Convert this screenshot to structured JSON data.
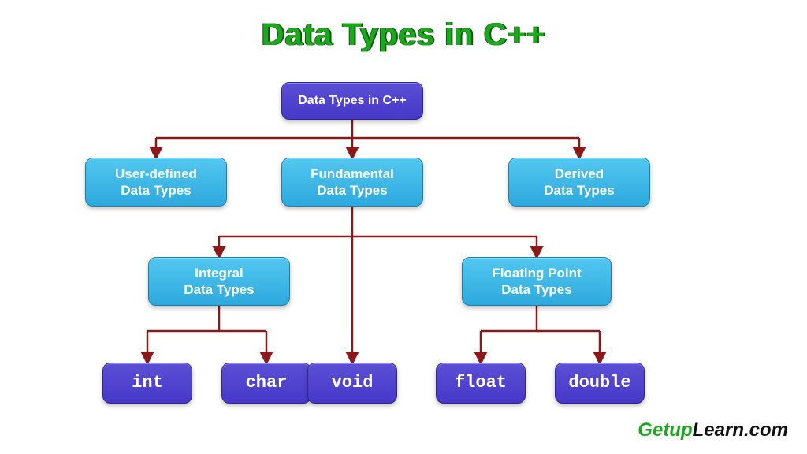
{
  "title": "Data Types in C++",
  "watermark": {
    "part1": "Getup",
    "part2": "Learn",
    "part3": ".com"
  },
  "nodes": {
    "root": "Data Types in C++",
    "userdef": "User-defined\nData Types",
    "fundamental": "Fundamental\nData  Types",
    "derived": "Derived\nData Types",
    "integral": "Integral\nData Types",
    "floating": "Floating  Point\nData Types",
    "int": "int",
    "char": "char",
    "void": "void",
    "float": "float",
    "double": "double"
  },
  "chart_data": {
    "type": "tree",
    "title": "Data Types in C++",
    "root": {
      "label": "Data Types in C++",
      "children": [
        {
          "label": "User-defined Data Types"
        },
        {
          "label": "Fundamental Data Types",
          "children": [
            {
              "label": "Integral Data Types",
              "children": [
                {
                  "label": "int"
                },
                {
                  "label": "char"
                }
              ]
            },
            {
              "label": "void"
            },
            {
              "label": "Floating Point Data Types",
              "children": [
                {
                  "label": "float"
                },
                {
                  "label": "double"
                }
              ]
            }
          ]
        },
        {
          "label": "Derived Data Types"
        }
      ]
    }
  },
  "colors": {
    "title": "#1ca81c",
    "purple": "#4738c9",
    "blue": "#2ea9dd",
    "connector": "#8a1a1a"
  }
}
